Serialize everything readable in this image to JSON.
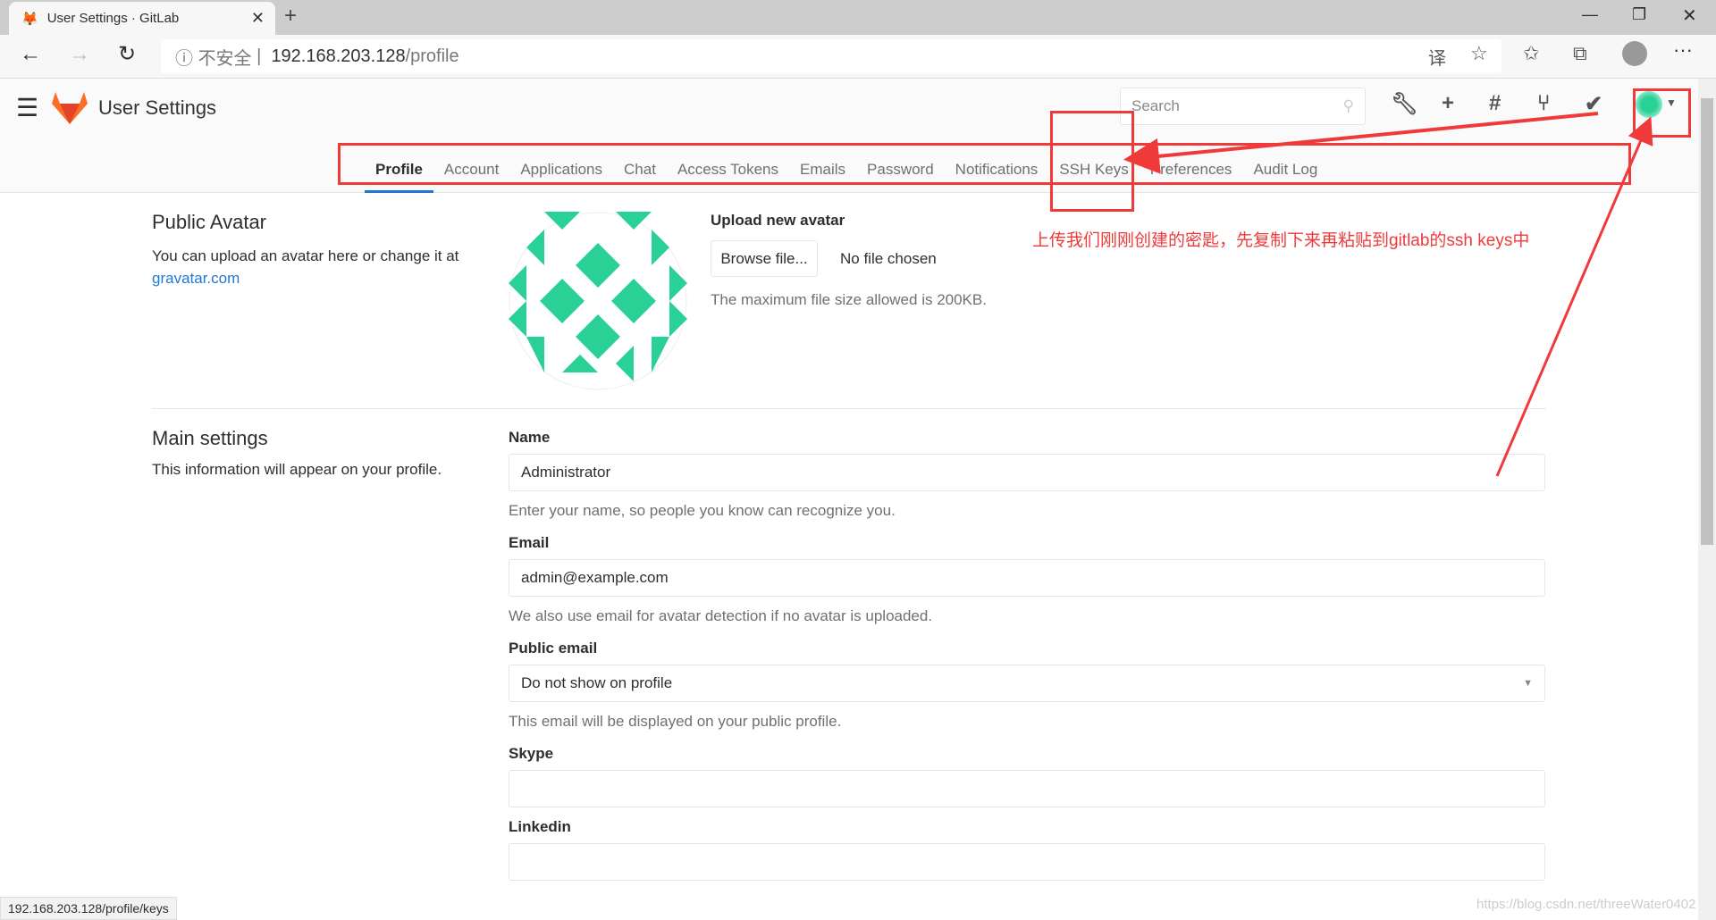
{
  "browser": {
    "tab_title": "User Settings · GitLab",
    "insecure": "不安全",
    "url_host": "192.168.203.128",
    "url_path": "/profile",
    "status_url": "192.168.203.128/profile/keys"
  },
  "header": {
    "title": "User Settings",
    "search_placeholder": "Search"
  },
  "nav": {
    "tabs": [
      "Profile",
      "Account",
      "Applications",
      "Chat",
      "Access Tokens",
      "Emails",
      "Password",
      "Notifications",
      "SSH Keys",
      "Preferences",
      "Audit Log"
    ],
    "active": "Profile"
  },
  "avatar": {
    "heading": "Public Avatar",
    "desc": "You can upload an avatar here or change it at",
    "link": "gravatar.com",
    "upload_label": "Upload new avatar",
    "browse": "Browse file...",
    "no_file": "No file chosen",
    "max_size": "The maximum file size allowed is 200KB.",
    "color": "#2ad196"
  },
  "main": {
    "heading": "Main settings",
    "desc": "This information will appear on your profile.",
    "fields": [
      {
        "label": "Name",
        "value": "Administrator",
        "help": "Enter your name, so people you know can recognize you."
      },
      {
        "label": "Email",
        "value": "admin@example.com",
        "help": "We also use email for avatar detection if no avatar is uploaded."
      },
      {
        "label": "Public email",
        "value": "Do not show on profile",
        "help": "This email will be displayed on your public profile."
      },
      {
        "label": "Skype",
        "value": "",
        "help": ""
      },
      {
        "label": "Linkedin",
        "value": "",
        "help": ""
      }
    ]
  },
  "annotation": {
    "text": "上传我们刚刚创建的密匙，先复制下来再粘贴到gitlab的ssh keys中",
    "color": "#f03a3a"
  },
  "watermark": "https://blog.csdn.net/threeWater0402"
}
